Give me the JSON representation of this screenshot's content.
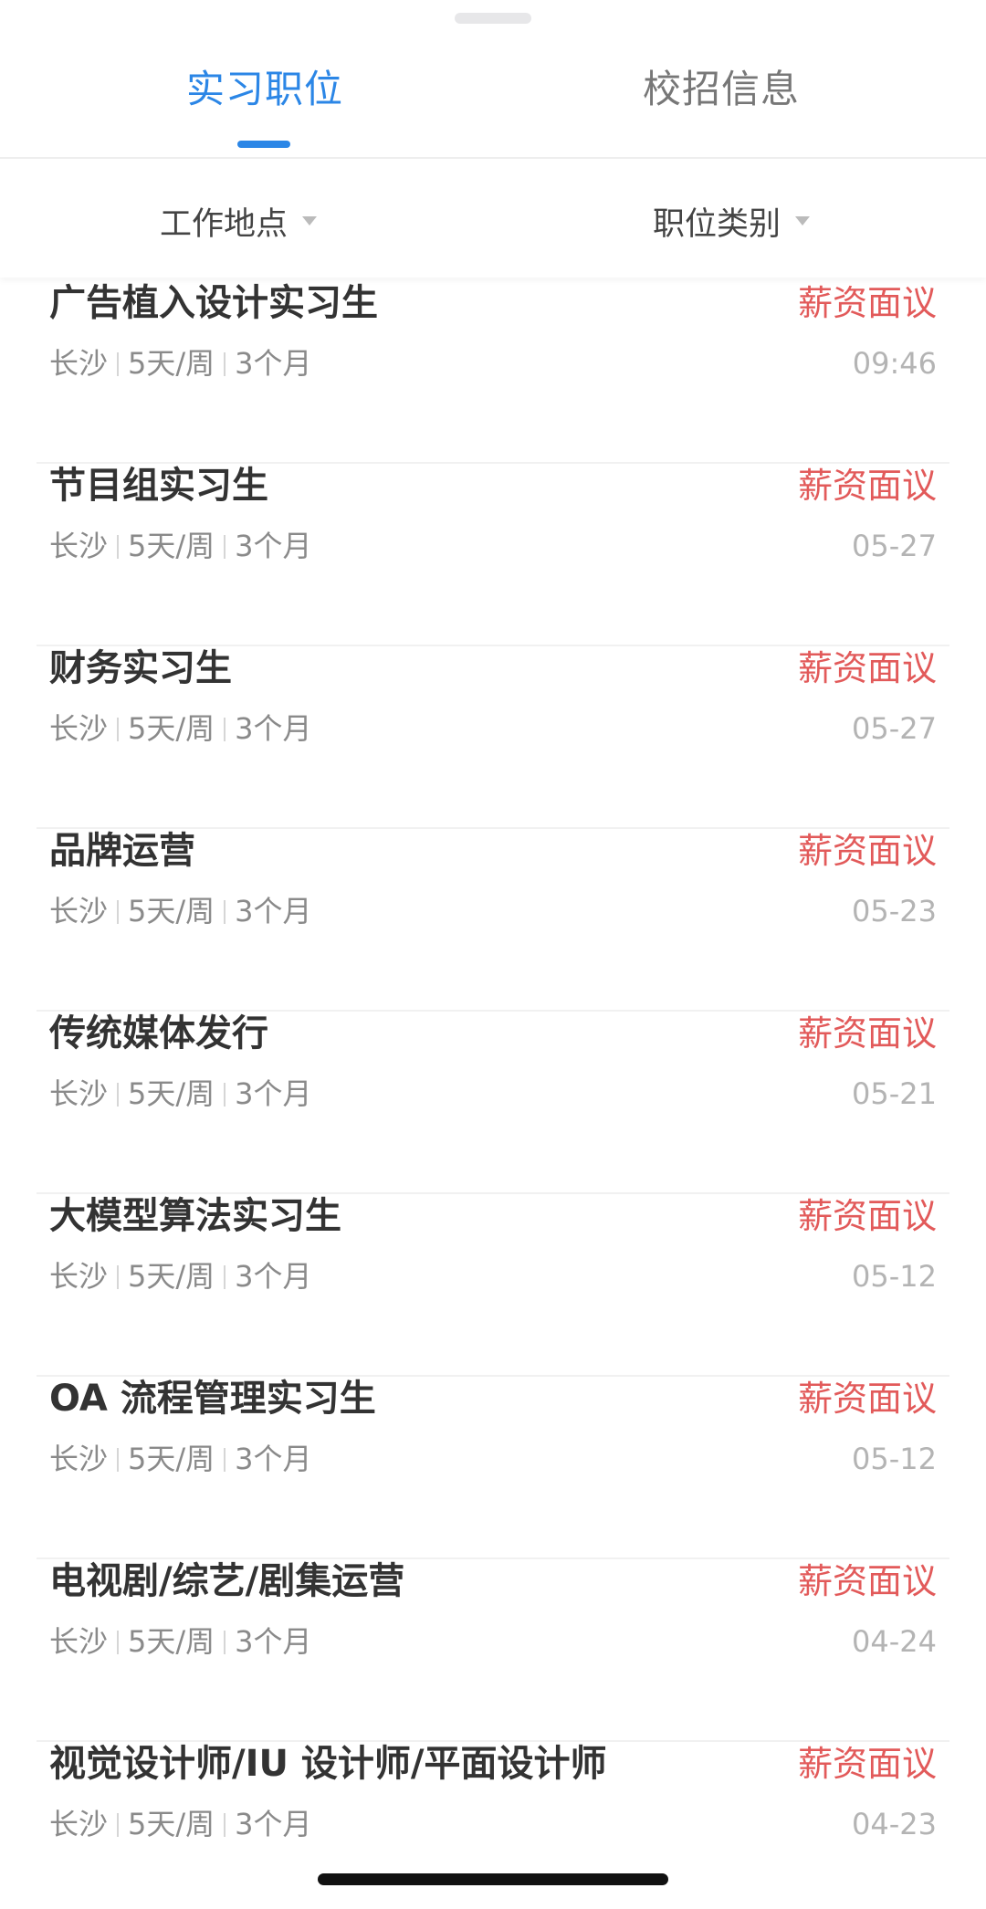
{
  "tabs": {
    "active": "实习职位",
    "inactive": "校招信息"
  },
  "filters": {
    "location": "工作地点",
    "category": "职位类别"
  },
  "jobs": [
    {
      "title": "广告植入设计实习生",
      "salary": "薪资面议",
      "city": "长沙",
      "days": "5天/周",
      "duration": "3个月",
      "date": "09:46"
    },
    {
      "title": "节目组实习生",
      "salary": "薪资面议",
      "city": "长沙",
      "days": "5天/周",
      "duration": "3个月",
      "date": "05-27"
    },
    {
      "title": "财务实习生",
      "salary": "薪资面议",
      "city": "长沙",
      "days": "5天/周",
      "duration": "3个月",
      "date": "05-27"
    },
    {
      "title": "品牌运营",
      "salary": "薪资面议",
      "city": "长沙",
      "days": "5天/周",
      "duration": "3个月",
      "date": "05-23"
    },
    {
      "title": "传统媒体发行",
      "salary": "薪资面议",
      "city": "长沙",
      "days": "5天/周",
      "duration": "3个月",
      "date": "05-21"
    },
    {
      "title": "大模型算法实习生",
      "salary": "薪资面议",
      "city": "长沙",
      "days": "5天/周",
      "duration": "3个月",
      "date": "05-12"
    },
    {
      "title": "OA 流程管理实习生",
      "salary": "薪资面议",
      "city": "长沙",
      "days": "5天/周",
      "duration": "3个月",
      "date": "05-12"
    },
    {
      "title": "电视剧/综艺/剧集运营",
      "salary": "薪资面议",
      "city": "长沙",
      "days": "5天/周",
      "duration": "3个月",
      "date": "04-24"
    },
    {
      "title": "视觉设计师/IU 设计师/平面设计师",
      "salary": "薪资面议",
      "city": "长沙",
      "days": "5天/周",
      "duration": "3个月",
      "date": "04-23"
    }
  ]
}
